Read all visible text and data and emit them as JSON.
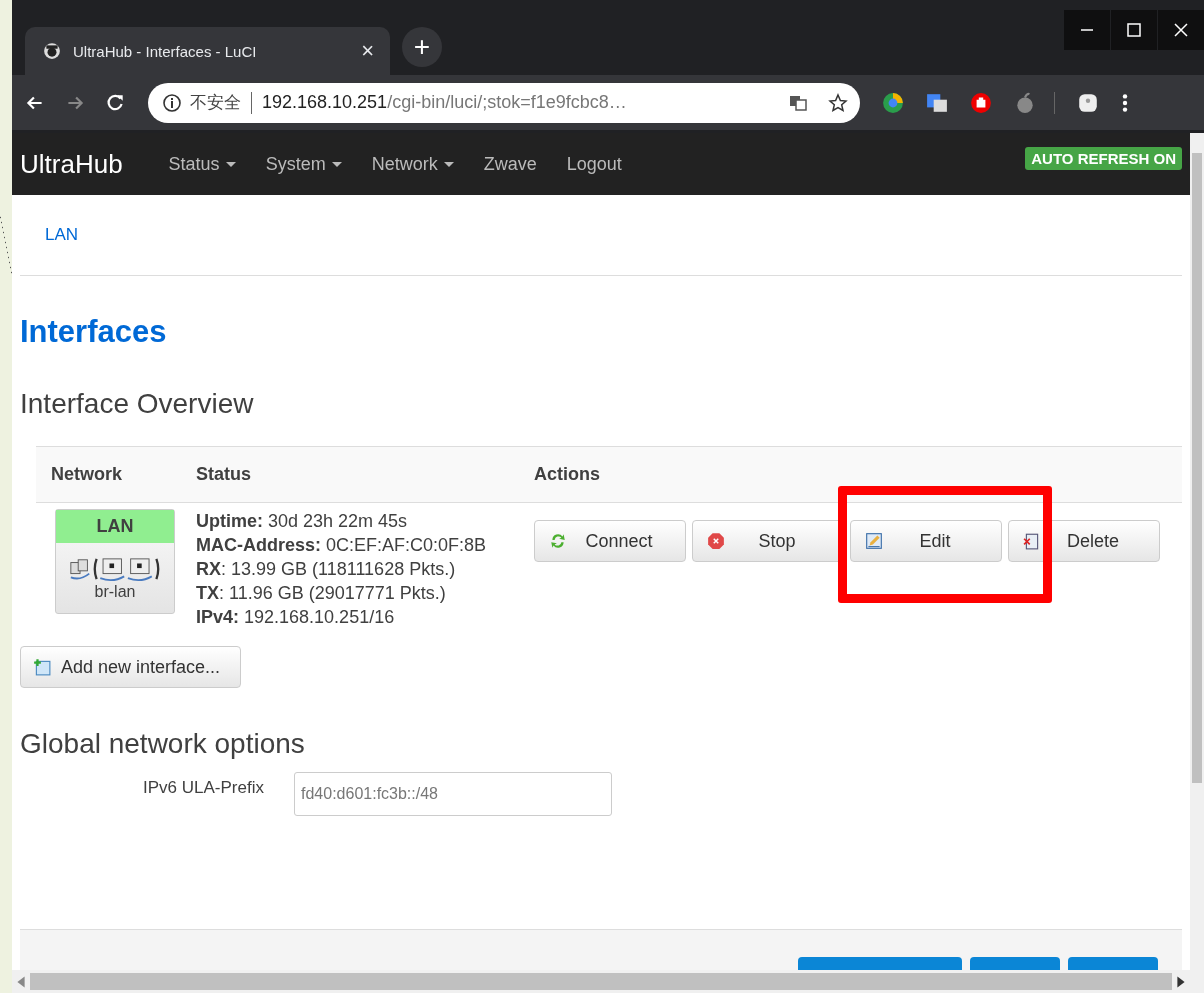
{
  "browser": {
    "tab_title": "UltraHub - Interfaces - LuCI",
    "tab_close": "×",
    "new_tab": "+",
    "security_label": "不安全",
    "url_host": "192.168.10.251",
    "url_path": "/cgi-bin/luci/;stok=f1e9fcbc8…"
  },
  "navbar": {
    "brand": "UltraHub",
    "menu": [
      {
        "label": "Status",
        "dropdown": true
      },
      {
        "label": "System",
        "dropdown": true
      },
      {
        "label": "Network",
        "dropdown": true
      },
      {
        "label": "Zwave",
        "dropdown": false
      },
      {
        "label": "Logout",
        "dropdown": false
      }
    ],
    "badge": "AUTO REFRESH ON"
  },
  "subnav": [
    "LAN"
  ],
  "page_title": "Interfaces",
  "section_title": "Interface Overview",
  "table": {
    "columns": [
      "Network",
      "Status",
      "Actions"
    ],
    "rows": [
      {
        "network": {
          "name": "LAN",
          "device": "br-lan"
        },
        "status": [
          "**Uptime:** 30d 23h 22m 45s",
          "**MAC-Address:** 0C:EF:AF:C0:0F:8B",
          "**RX**: 13.99 GB (118111628 Pkts.)",
          "**TX**: 11.96 GB (29017771 Pkts.)",
          "**IPv4:** 192.168.10.251/16"
        ],
        "actions": [
          {
            "label": "Connect",
            "kind": "reload"
          },
          {
            "label": "Stop",
            "kind": "stop"
          },
          {
            "label": "Edit",
            "kind": "edit"
          },
          {
            "label": "Delete",
            "kind": "delete"
          }
        ]
      }
    ]
  },
  "add_button": "Add new interface...",
  "global_title": "Global network options",
  "fields": [
    {
      "label": "IPv6 ULA-Prefix",
      "value": "fd40:d601:fc3b::/48"
    }
  ],
  "footer_buttons": [
    {
      "kind": "wide"
    },
    {
      "kind": "narrow"
    },
    {
      "kind": "narrow"
    }
  ],
  "annotation": {
    "kind": "frame"
  }
}
